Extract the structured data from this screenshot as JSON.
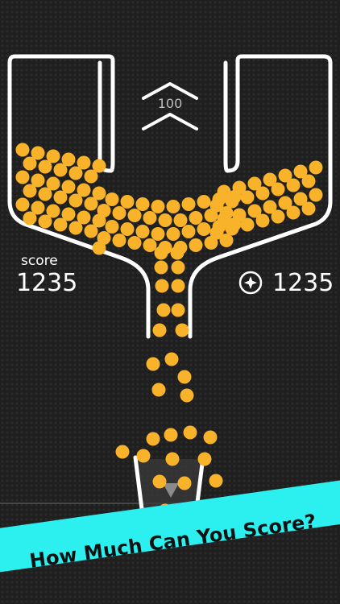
{
  "hud": {
    "score_label": "score",
    "score_value": "1235",
    "coin_value": "1235",
    "ball_count": "100"
  },
  "banner": {
    "text": "How Much Can You Score?"
  },
  "icons": {
    "coin": "coin-star-icon",
    "release": "double-chevron-up-icon",
    "cup_arrow": "down-arrow-icon"
  },
  "colors": {
    "ball": "#f8b32a",
    "ball_shade": "#e89a15",
    "banner": "#2cf0ef",
    "outline": "#ffffff"
  }
}
